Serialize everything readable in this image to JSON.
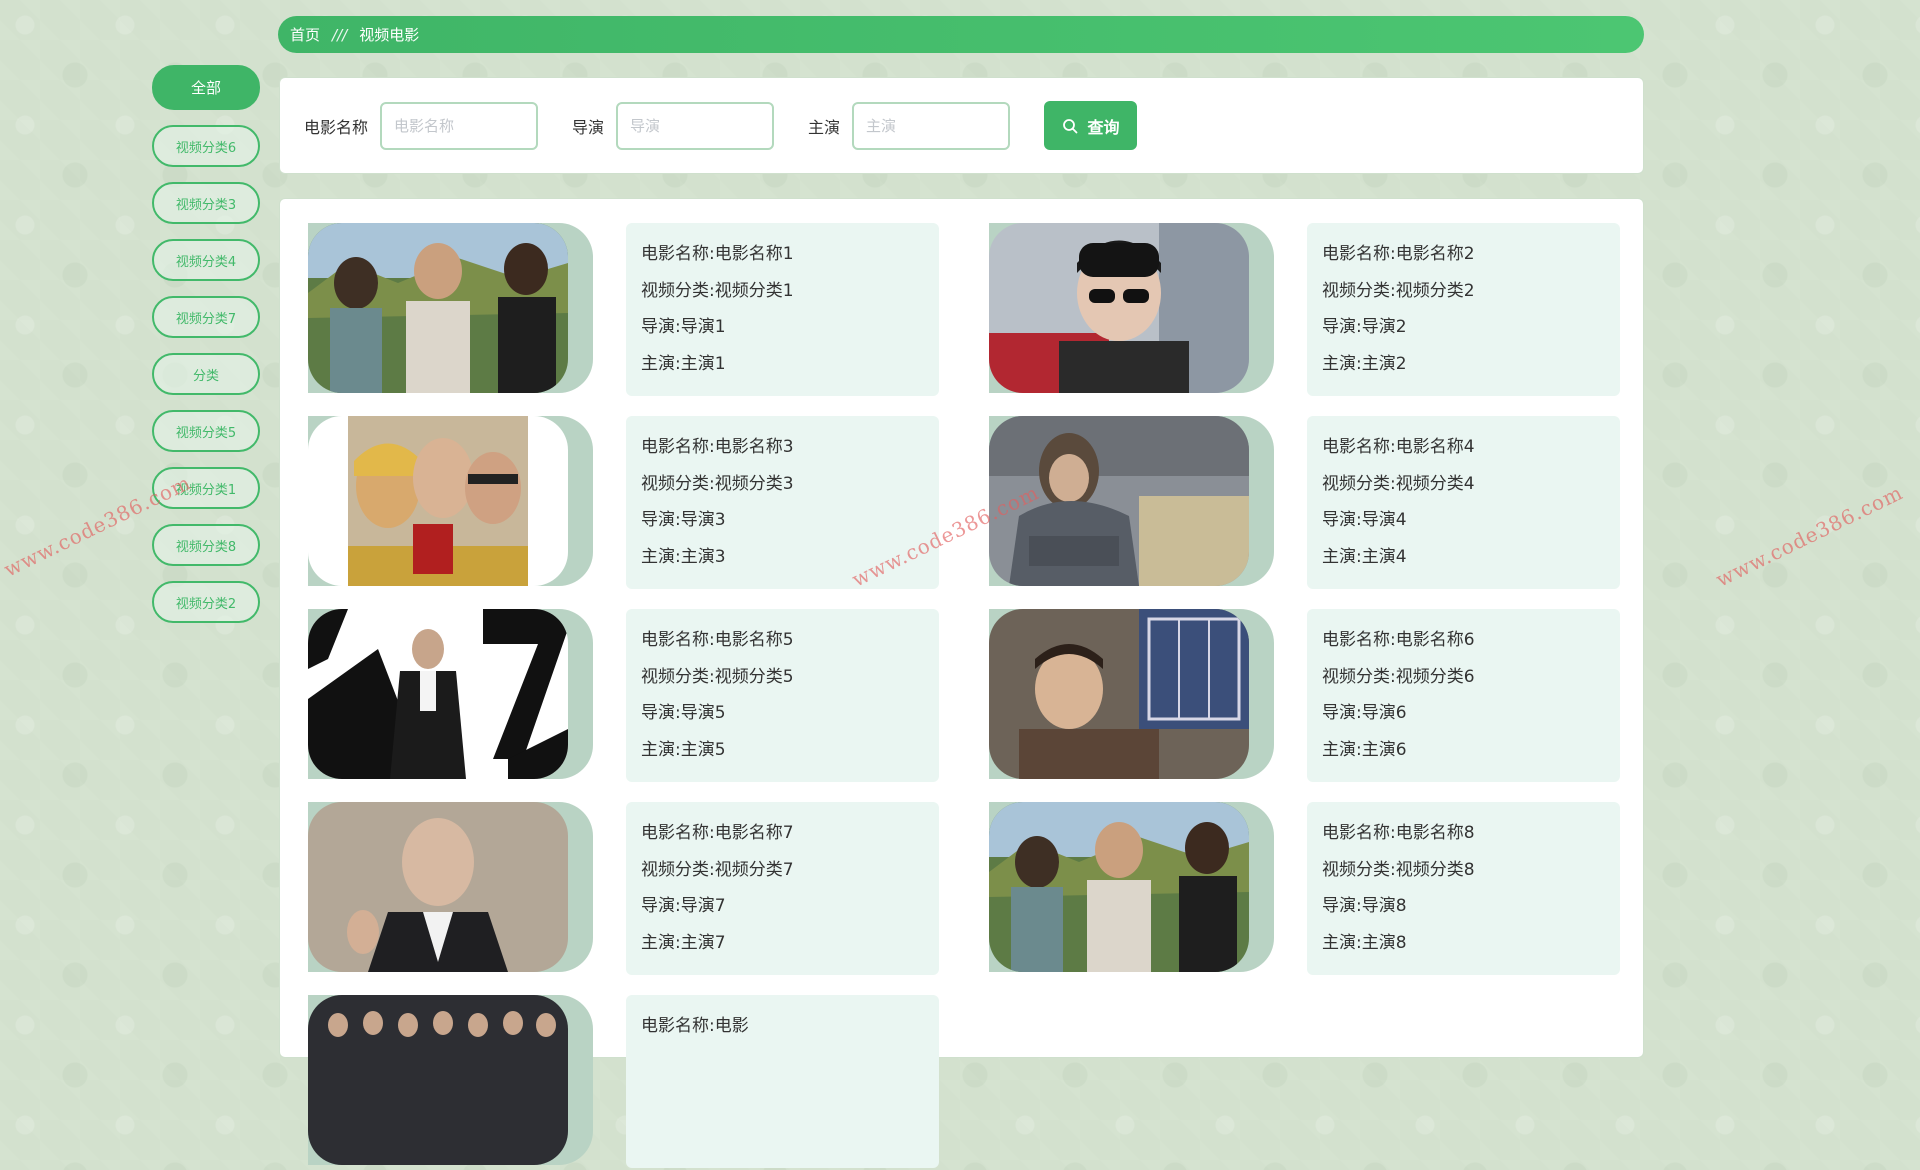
{
  "breadcrumb": {
    "home": "首页",
    "separator": "///",
    "current": "视频电影"
  },
  "categories": [
    "全部",
    "视频分类6",
    "视频分类3",
    "视频分类4",
    "视频分类7",
    "分类",
    "视频分类5",
    "视频分类1",
    "视频分类8",
    "视频分类2"
  ],
  "search": {
    "name_label": "电影名称",
    "name_placeholder": "电影名称",
    "director_label": "导演",
    "director_placeholder": "导演",
    "actor_label": "主演",
    "actor_placeholder": "主演",
    "button_label": "查询",
    "button_icon": "search-icon"
  },
  "movies": [
    {
      "title": "电影名称:电影名称1",
      "category": "视频分类:视频分类1",
      "director": "导演:导演1",
      "actor": "主演:主演1"
    },
    {
      "title": "电影名称:电影名称2",
      "category": "视频分类:视频分类2",
      "director": "导演:导演2",
      "actor": "主演:主演2"
    },
    {
      "title": "电影名称:电影名称3",
      "category": "视频分类:视频分类3",
      "director": "导演:导演3",
      "actor": "主演:主演3"
    },
    {
      "title": "电影名称:电影名称4",
      "category": "视频分类:视频分类4",
      "director": "导演:导演4",
      "actor": "主演:主演4"
    },
    {
      "title": "电影名称:电影名称5",
      "category": "视频分类:视频分类5",
      "director": "导演:导演5",
      "actor": "主演:主演5"
    },
    {
      "title": "电影名称:电影名称6",
      "category": "视频分类:视频分类6",
      "director": "导演:导演6",
      "actor": "主演:主演6"
    },
    {
      "title": "电影名称:电影名称7",
      "category": "视频分类:视频分类7",
      "director": "导演:导演7",
      "actor": "主演:主演7"
    },
    {
      "title": "电影名称:电影名称8",
      "category": "视频分类:视频分类8",
      "director": "导演:导演8",
      "actor": "主演:主演8"
    },
    {
      "title": "电影名称:电影",
      "category": "",
      "director": "",
      "actor": ""
    }
  ],
  "watermark": "www.code386.com",
  "colors": {
    "accent": "#3fb567",
    "card_bg": "#eaf6f2",
    "watermark": "#e26060"
  }
}
